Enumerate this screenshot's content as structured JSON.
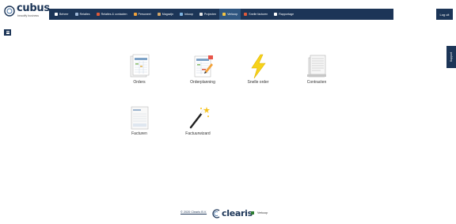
{
  "brand": {
    "name": "cubus",
    "tagline": "beautify business"
  },
  "nav": {
    "items": [
      {
        "label": "Beheer",
        "icon": "home-icon",
        "color": "#ffffff"
      },
      {
        "label": "Relaties",
        "icon": "relations-icon",
        "color": "#9fb8d8"
      },
      {
        "label": "Relaties & contacten",
        "icon": "contacts-icon",
        "color": "#e05a3a"
      },
      {
        "label": "Personeel",
        "icon": "personnel-icon",
        "color": "#f2a23a"
      },
      {
        "label": "Magazijn",
        "icon": "warehouse-icon",
        "color": "#d4a86a"
      },
      {
        "label": "Inkoop",
        "icon": "purchase-icon",
        "color": "#7fb3e0"
      },
      {
        "label": "Projecten",
        "icon": "projects-icon",
        "color": "#e8e8e8"
      },
      {
        "label": "Verkoop",
        "icon": "sales-icon",
        "color": "#f4c542",
        "active": true
      },
      {
        "label": "Snelle facturen",
        "icon": "invoice-icon",
        "color": "#e05a3a"
      },
      {
        "label": "Rapportage",
        "icon": "report-icon",
        "color": "#ffffff"
      }
    ],
    "logout_label": "Log uit"
  },
  "support_label": "Support",
  "tiles": [
    {
      "label": "Orders",
      "icon": "orders-icon"
    },
    {
      "label": "Orderplanning",
      "icon": "order-planning-icon"
    },
    {
      "label": "Snelle order",
      "icon": "lightning-icon"
    },
    {
      "label": "Contracten",
      "icon": "contracts-icon"
    },
    {
      "label": "Facturen",
      "icon": "invoices-icon"
    },
    {
      "label": "Factuurwizard",
      "icon": "magic-wand-icon"
    }
  ],
  "footer": {
    "copyright": "© 2020 Clearis B.V.",
    "company_logo_text": "clearis",
    "current_page": "Verkoop"
  },
  "colors": {
    "primary": "#1c3557",
    "active_nav": "#2f5680",
    "accent_yellow": "#f4c542"
  }
}
